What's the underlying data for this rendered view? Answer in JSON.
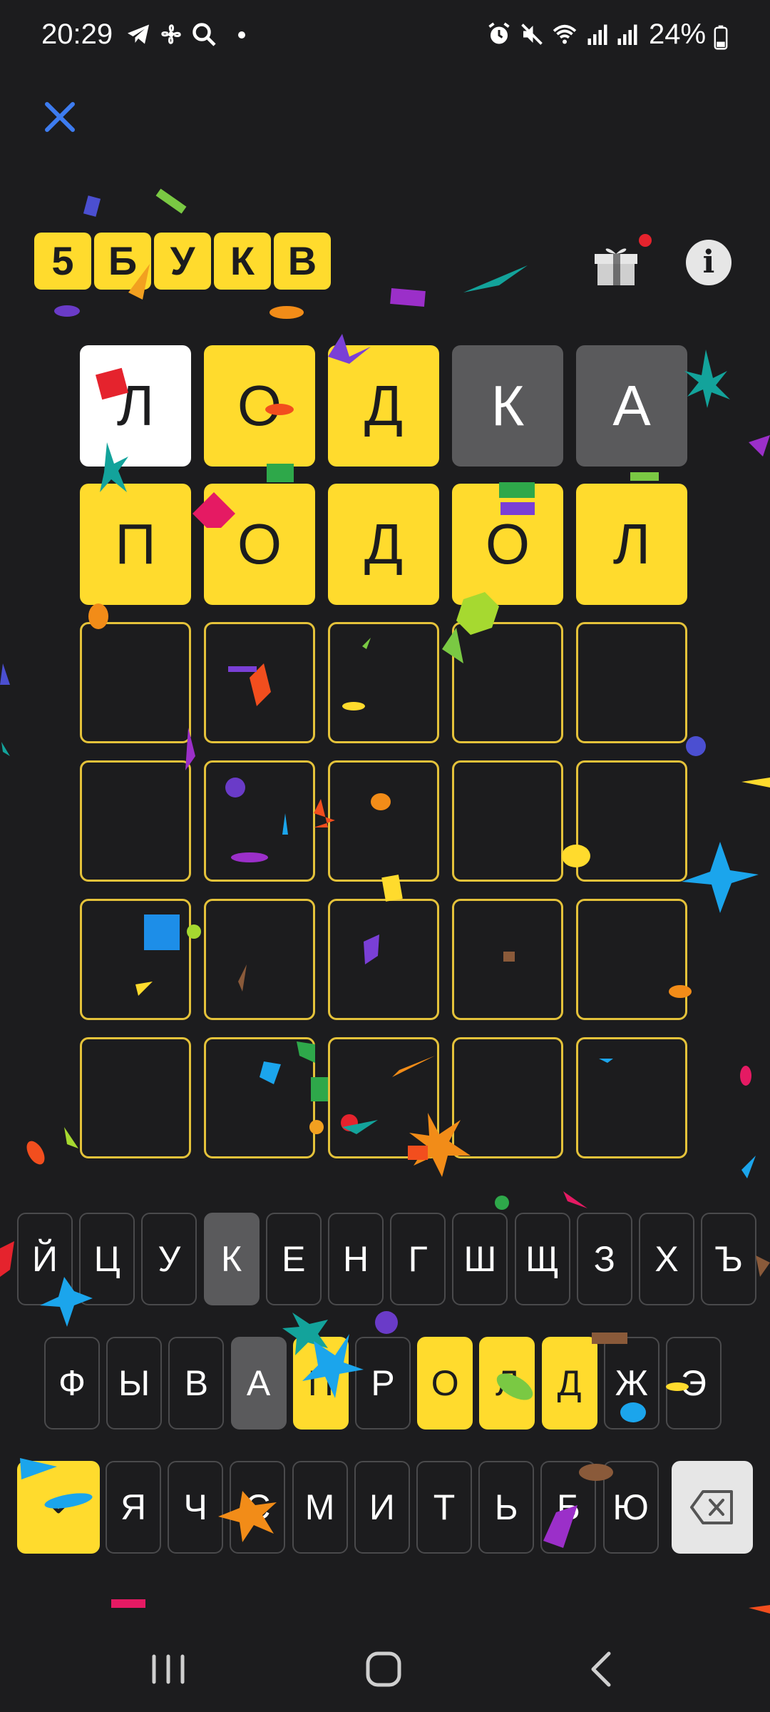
{
  "status_bar": {
    "time": "20:29",
    "battery": "24%",
    "left_icons": [
      "telegram-icon",
      "fan-icon",
      "search-icon",
      "dot-icon"
    ],
    "right_icons": [
      "alarm-icon",
      "mute-icon",
      "wifi-icon",
      "signal-icon",
      "signal-icon",
      "battery-icon"
    ]
  },
  "header": {
    "logo_letters": [
      "5",
      "Б",
      "У",
      "К",
      "В"
    ],
    "close_icon": "close-icon",
    "gift_icon": "gift-icon",
    "info_label": "i"
  },
  "board": {
    "rows": [
      [
        {
          "letter": "Л",
          "state": "white"
        },
        {
          "letter": "О",
          "state": "yellow"
        },
        {
          "letter": "Д",
          "state": "yellow"
        },
        {
          "letter": "К",
          "state": "gray"
        },
        {
          "letter": "А",
          "state": "gray"
        }
      ],
      [
        {
          "letter": "П",
          "state": "yellow"
        },
        {
          "letter": "О",
          "state": "yellow"
        },
        {
          "letter": "Д",
          "state": "yellow"
        },
        {
          "letter": "О",
          "state": "yellow"
        },
        {
          "letter": "Л",
          "state": "yellow"
        }
      ],
      [
        {
          "letter": "",
          "state": "empty"
        },
        {
          "letter": "",
          "state": "empty"
        },
        {
          "letter": "",
          "state": "empty"
        },
        {
          "letter": "",
          "state": "empty"
        },
        {
          "letter": "",
          "state": "empty"
        }
      ],
      [
        {
          "letter": "",
          "state": "empty"
        },
        {
          "letter": "",
          "state": "empty"
        },
        {
          "letter": "",
          "state": "empty"
        },
        {
          "letter": "",
          "state": "empty"
        },
        {
          "letter": "",
          "state": "empty"
        }
      ],
      [
        {
          "letter": "",
          "state": "empty"
        },
        {
          "letter": "",
          "state": "empty"
        },
        {
          "letter": "",
          "state": "empty"
        },
        {
          "letter": "",
          "state": "empty"
        },
        {
          "letter": "",
          "state": "empty"
        }
      ],
      [
        {
          "letter": "",
          "state": "empty"
        },
        {
          "letter": "",
          "state": "empty"
        },
        {
          "letter": "",
          "state": "empty"
        },
        {
          "letter": "",
          "state": "empty"
        },
        {
          "letter": "",
          "state": "empty"
        }
      ]
    ]
  },
  "keyboard": {
    "row1": [
      {
        "k": "Й",
        "s": "none"
      },
      {
        "k": "Ц",
        "s": "none"
      },
      {
        "k": "У",
        "s": "none"
      },
      {
        "k": "К",
        "s": "gray"
      },
      {
        "k": "Е",
        "s": "none"
      },
      {
        "k": "Н",
        "s": "none"
      },
      {
        "k": "Г",
        "s": "none"
      },
      {
        "k": "Ш",
        "s": "none"
      },
      {
        "k": "Щ",
        "s": "none"
      },
      {
        "k": "З",
        "s": "none"
      },
      {
        "k": "Х",
        "s": "none"
      },
      {
        "k": "Ъ",
        "s": "none"
      }
    ],
    "row2": [
      {
        "k": "Ф",
        "s": "none"
      },
      {
        "k": "Ы",
        "s": "none"
      },
      {
        "k": "В",
        "s": "none"
      },
      {
        "k": "А",
        "s": "gray"
      },
      {
        "k": "П",
        "s": "yellow"
      },
      {
        "k": "Р",
        "s": "none"
      },
      {
        "k": "О",
        "s": "yellow"
      },
      {
        "k": "Л",
        "s": "yellow"
      },
      {
        "k": "Д",
        "s": "yellow"
      },
      {
        "k": "Ж",
        "s": "none"
      },
      {
        "k": "Э",
        "s": "none"
      }
    ],
    "row3": [
      {
        "k": "Я",
        "s": "none"
      },
      {
        "k": "Ч",
        "s": "none"
      },
      {
        "k": "С",
        "s": "none"
      },
      {
        "k": "М",
        "s": "none"
      },
      {
        "k": "И",
        "s": "none"
      },
      {
        "k": "Т",
        "s": "none"
      },
      {
        "k": "Ь",
        "s": "none"
      },
      {
        "k": "Б",
        "s": "none"
      },
      {
        "k": "Ю",
        "s": "none"
      }
    ],
    "enter_icon": "checkmark-icon",
    "backspace_icon": "backspace-icon"
  },
  "nav_bar": {
    "items": [
      "recent-apps-icon",
      "home-icon",
      "back-icon"
    ]
  },
  "colors": {
    "background": "#1c1c1e",
    "yellow": "#ffdb2d",
    "gray": "#5a5a5c",
    "white_tile": "#ffffff",
    "empty_border": "#e4c23a",
    "close_blue": "#3d7cf0"
  }
}
